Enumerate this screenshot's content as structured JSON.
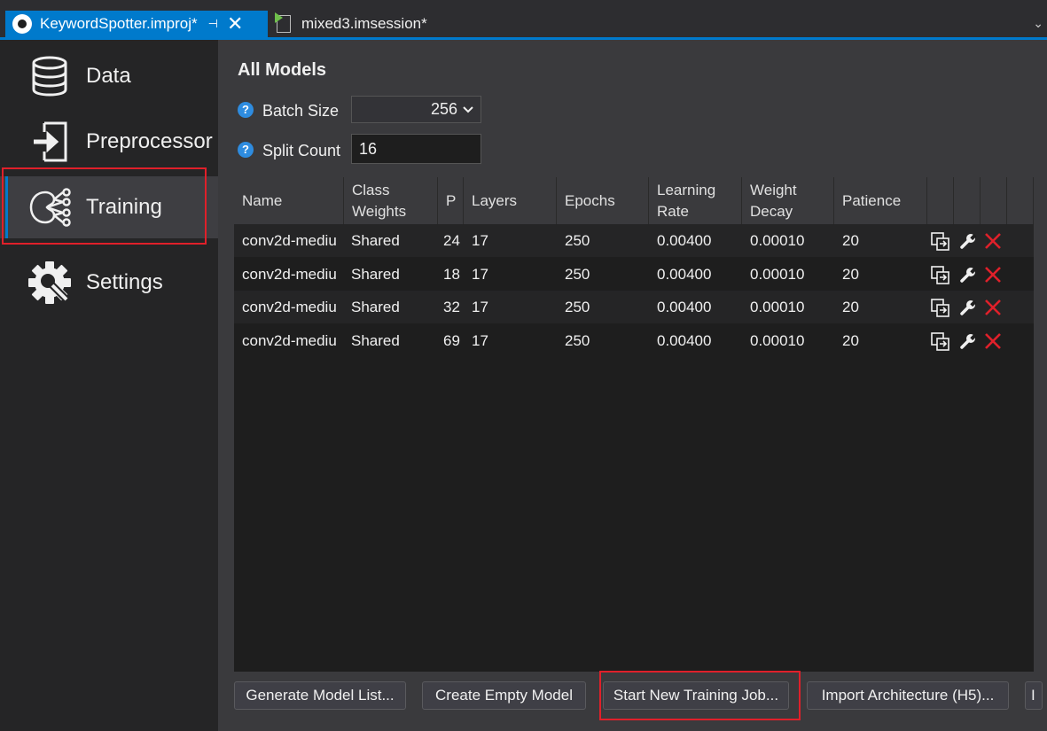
{
  "tabs": {
    "active": {
      "title": "KeywordSpotter.improj*",
      "pin": "⊣",
      "close": "✕"
    },
    "inactive": {
      "title": "mixed3.imsession*"
    },
    "overflow": "⌄"
  },
  "sidebar": {
    "items": [
      {
        "label": "Data",
        "icon": "database-icon"
      },
      {
        "label": "Preprocessor",
        "icon": "import-arrow-icon"
      },
      {
        "label": "Training",
        "icon": "neural-network-icon"
      },
      {
        "label": "Settings",
        "icon": "gear-wrench-icon"
      }
    ],
    "selected": "Training"
  },
  "main": {
    "heading": "All Models",
    "batch_size": {
      "label": "Batch Size",
      "value": "256",
      "help": "?"
    },
    "split_count": {
      "label": "Split Count",
      "value": "16",
      "help": "?"
    }
  },
  "table": {
    "columns": [
      "Name",
      "Class Weights",
      "P",
      "Layers",
      "Epochs",
      "Learning Rate",
      "Weight Decay",
      "Patience"
    ],
    "rows": [
      {
        "name": "conv2d-mediu",
        "class_weights": "Shared",
        "p": "24",
        "layers": "17",
        "epochs": "250",
        "learning_rate": "0.00400",
        "weight_decay": "0.00010",
        "patience": "20"
      },
      {
        "name": "conv2d-mediu",
        "class_weights": "Shared",
        "p": "18",
        "layers": "17",
        "epochs": "250",
        "learning_rate": "0.00400",
        "weight_decay": "0.00010",
        "patience": "20"
      },
      {
        "name": "conv2d-mediu",
        "class_weights": "Shared",
        "p": "32",
        "layers": "17",
        "epochs": "250",
        "learning_rate": "0.00400",
        "weight_decay": "0.00010",
        "patience": "20"
      },
      {
        "name": "conv2d-mediu",
        "class_weights": "Shared",
        "p": "69",
        "layers": "17",
        "epochs": "250",
        "learning_rate": "0.00400",
        "weight_decay": "0.00010",
        "patience": "20"
      }
    ],
    "row_actions": [
      "duplicate-icon",
      "wrench-icon",
      "delete-icon"
    ]
  },
  "buttons": {
    "generate": "Generate Model List...",
    "create_empty": "Create Empty Model",
    "start_training": "Start New Training Job...",
    "import_arch": "Import Architecture (H5)...",
    "overflow": "I"
  },
  "colors": {
    "accent": "#007acc",
    "highlight": "#e0202a",
    "delete": "#e0202a",
    "help": "#2e8ce0"
  }
}
